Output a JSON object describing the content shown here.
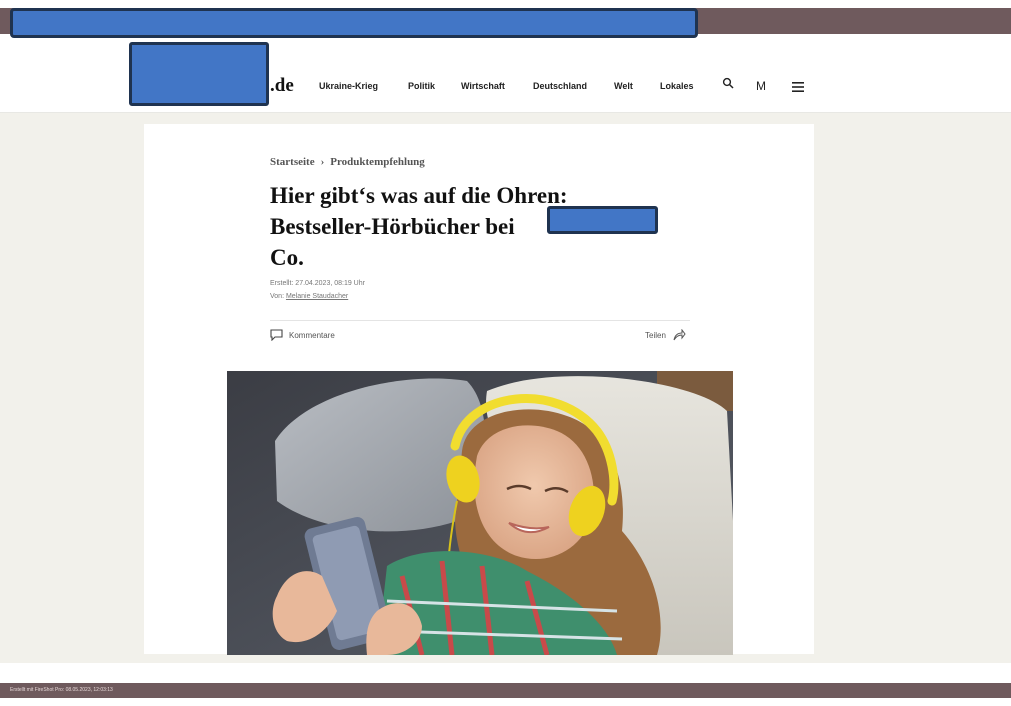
{
  "site": {
    "domain_suffix": ".de"
  },
  "nav": {
    "items": [
      {
        "label": "Ukraine-Krieg"
      },
      {
        "label": "Politik"
      },
      {
        "label": "Wirtschaft"
      },
      {
        "label": "Deutschland"
      },
      {
        "label": "Welt"
      },
      {
        "label": "Lokales"
      }
    ],
    "icons": [
      "search-icon",
      "m-icon",
      "menu-icon"
    ],
    "m_label": "M"
  },
  "breadcrumb": {
    "home": "Startseite",
    "separator": "›",
    "current": "Produktempfehlung"
  },
  "article": {
    "headline_line1": "Hier gibt‘s was auf die Ohren:",
    "headline_line2_start": "Bestseller-Hörbücher bei",
    "headline_line2_end": "&",
    "headline_line3": "Co.",
    "created_label": "Erstellt:",
    "created_date": "27.04.2023, 08:19 Uhr",
    "author_label": "Von:",
    "author_name": "Melanie Staudacher",
    "comments_label": "Kommentare",
    "share_label": "Teilen"
  },
  "footer": {
    "text": "Erstellt mit FireShot Pro: 08.05.2023, 12:03:13"
  },
  "colors": {
    "redaction_fill": "#4276c6",
    "redaction_border": "#1f3350",
    "frame_bar": "#6f5a5d",
    "page_bg": "#f2f1eb",
    "headphone_yellow": "#f1dd2f"
  }
}
